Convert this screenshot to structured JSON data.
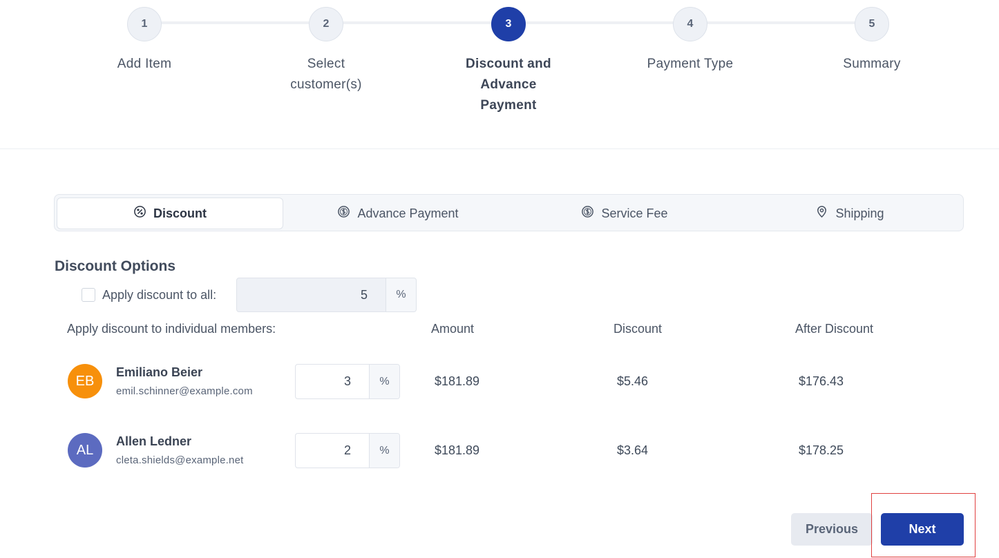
{
  "stepper": {
    "steps": [
      {
        "number": "1",
        "label": "Add Item"
      },
      {
        "number": "2",
        "label": "Select customer(s)"
      },
      {
        "number": "3",
        "label": "Discount and Advance Payment"
      },
      {
        "number": "4",
        "label": "Payment Type"
      },
      {
        "number": "5",
        "label": "Summary"
      }
    ],
    "active_step": 3
  },
  "tabs": [
    {
      "label": "Discount",
      "icon": "discount-badge-icon",
      "active": true
    },
    {
      "label": "Advance Payment",
      "icon": "dollar-circle-icon",
      "active": false
    },
    {
      "label": "Service Fee",
      "icon": "dollar-circle-icon",
      "active": false
    },
    {
      "label": "Shipping",
      "icon": "location-pin-icon",
      "active": false
    }
  ],
  "discount": {
    "title": "Discount Options",
    "apply_all_label": "Apply discount to all:",
    "apply_all_checked": false,
    "apply_all_value": "5",
    "unit": "%",
    "individual_label": "Apply discount to individual members:",
    "columns": {
      "amount": "Amount",
      "discount": "Discount",
      "after": "After Discount"
    },
    "members": [
      {
        "initials": "EB",
        "avatar_color": "#f7900b",
        "name": "Emiliano Beier",
        "email": "emil.schinner@example.com",
        "percent": "3",
        "amount": "$181.89",
        "discount": "$5.46",
        "after": "$176.43"
      },
      {
        "initials": "AL",
        "avatar_color": "#5c6bc0",
        "name": "Allen Ledner",
        "email": "cleta.shields@example.net",
        "percent": "2",
        "amount": "$181.89",
        "discount": "$3.64",
        "after": "$178.25"
      }
    ]
  },
  "buttons": {
    "previous": "Previous",
    "next": "Next"
  },
  "colors": {
    "primary": "#1f3fa8",
    "highlight": "#e0403f"
  }
}
